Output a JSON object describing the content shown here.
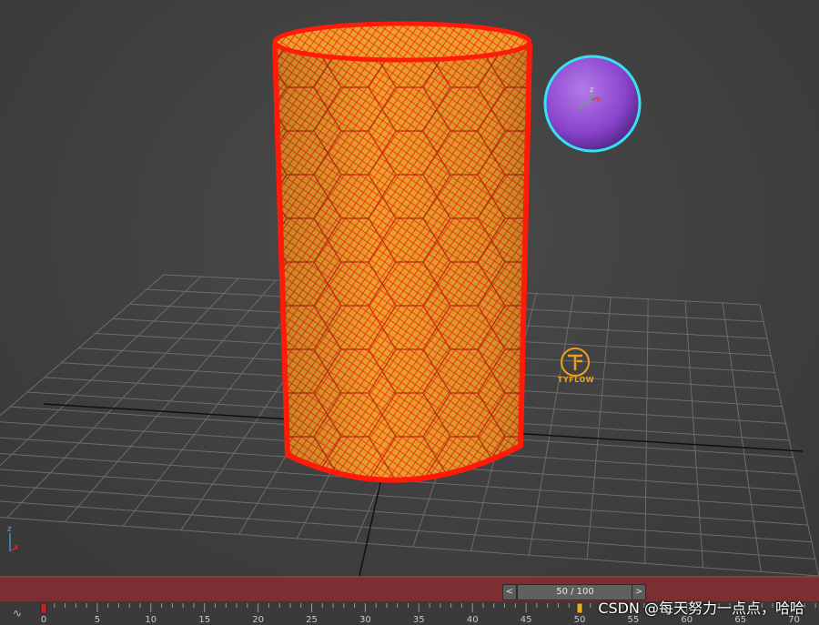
{
  "viewport": {
    "background": "#444444",
    "grid_color": "#6a6a6a",
    "axis_line_color": "#111111",
    "cylinder": {
      "fill": "#e89a2a",
      "wire": "#ff1a0a"
    },
    "sphere": {
      "fill": "#8e4ad0",
      "outline": "#34e0f0"
    },
    "gizmo": {
      "z": "z",
      "x": "x",
      "y": "y"
    },
    "logo": {
      "text": "TYFLOW",
      "color": "#f0a020"
    },
    "corner_axis": {
      "z": "z",
      "x": "x"
    }
  },
  "timeslider": {
    "prev_icon": "chevron-left-icon",
    "next_icon": "chevron-right-icon",
    "prev_label": "<",
    "next_label": ">",
    "frame_readout": "50 / 100",
    "current_frame": 50,
    "total_frames": 100
  },
  "trackbar": {
    "curve_icon": "curve-editor-icon",
    "curve_glyph": "∿",
    "ticks": [
      "0",
      "5",
      "10",
      "15",
      "20",
      "25",
      "30",
      "35",
      "40",
      "45",
      "50",
      "55",
      "60",
      "65",
      "70"
    ],
    "key_frames": [
      0,
      50
    ]
  },
  "watermark": "CSDN @每天努力一点点，哈哈"
}
